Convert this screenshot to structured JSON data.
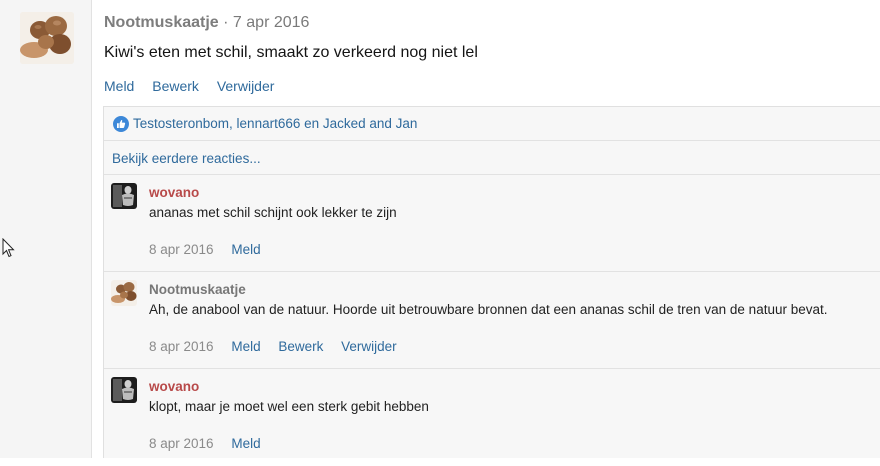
{
  "post": {
    "author": "Nootmuskaatje",
    "separator": " · ",
    "date": "7 apr 2016",
    "body": "Kiwi's eten met schil, smaakt zo verkeerd nog niet lel",
    "actions": {
      "report": "Meld",
      "edit": "Bewerk",
      "delete": "Verwijder"
    }
  },
  "reactions": {
    "likes_text": "Testosteronbom, lennart666 en Jacked and Jan",
    "earlier_link": "Bekijk eerdere reacties..."
  },
  "comments": [
    {
      "author": "wovano",
      "text": "ananas met schil schijnt ook lekker te zijn",
      "date": "8 apr 2016",
      "actions": {
        "report": "Meld"
      }
    },
    {
      "author": "Nootmuskaatje",
      "text": "Ah, de anabool van de natuur. Hoorde uit betrouwbare bronnen dat een ananas schil de tren van de natuur bevat.",
      "date": "8 apr 2016",
      "actions": {
        "report": "Meld",
        "edit": "Bewerk",
        "delete": "Verwijder"
      }
    },
    {
      "author": "wovano",
      "text": "klopt, maar je moet wel een sterk gebit hebben",
      "date": "8 apr 2016",
      "actions": {
        "report": "Meld"
      }
    }
  ],
  "colors": {
    "link": "#2f6a9c",
    "author_red": "#b84a4a",
    "author_grey": "#777777"
  },
  "icons": {
    "like": "thumbs-up-icon",
    "cursor": "mouse-pointer-icon"
  }
}
